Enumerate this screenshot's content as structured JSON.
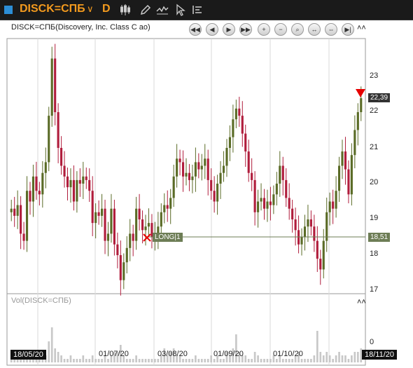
{
  "toolbar": {
    "symbol": "DISCK=СПБ",
    "dropdown_icon": "chevron-down-icon",
    "period": "D",
    "icons": [
      "candlestick-icon",
      "pencil-icon",
      "line-chart-icon",
      "cursor-icon",
      "list-icon"
    ]
  },
  "chart": {
    "title": "DISCK=СПБ(Discovery, Inc. Class C ао)",
    "vol_title": "Vol(DISCK=СПБ)",
    "nav_icons": [
      "first-icon",
      "previous-icon",
      "next-icon",
      "last-icon",
      "zoom-in-icon",
      "zoom-out-icon",
      "zoom-fit-icon",
      "compress-icon",
      "expand-icon",
      "end-icon"
    ],
    "collapse_icon": "collapse-up-icon",
    "y_ticks": [
      "23",
      "22",
      "21",
      "20",
      "19",
      "18",
      "17"
    ],
    "vol_ticks": [
      "0"
    ],
    "last_price": "22,39",
    "position_price": "18,51",
    "position_label": "LONG|1",
    "x_labels": [
      "18/05/20",
      "01/07/20",
      "03/08/20",
      "01/09/20",
      "01/10/20",
      "18/11/20"
    ],
    "colors": {
      "up": "#5a6b26",
      "down": "#b01d3c",
      "last": "#333333",
      "position": "#6d7d55",
      "sell_marker": "#e60000",
      "buy_marker": "#e60000"
    }
  },
  "chart_data": {
    "type": "candlestick",
    "y_range": [
      16.8,
      23.6
    ],
    "y_ticks": [
      17,
      18,
      19,
      20,
      21,
      22,
      23
    ],
    "x_start": "18/05/20",
    "x_end": "18/11/20",
    "close": [
      19.3,
      19.1,
      19.4,
      18.6,
      18.4,
      19.8,
      19.5,
      20.2,
      19.8,
      19.7,
      20.3,
      20.6,
      21.9,
      23.5,
      22.0,
      21.0,
      20.5,
      20.2,
      19.9,
      20.1,
      19.5,
      20.1,
      20.0,
      20.2,
      20.1,
      19.8,
      18.9,
      19.2,
      19.1,
      19.3,
      18.4,
      18.6,
      19.3,
      18.3,
      18.0,
      17.3,
      17.8,
      18.2,
      18.6,
      18.4,
      19.3,
      19.0,
      18.7,
      18.8,
      18.9,
      18.5,
      18.6,
      18.8,
      19.2,
      19.4,
      19.3,
      19.6,
      20.2,
      20.7,
      20.6,
      20.2,
      20.3,
      20.1,
      20.2,
      20.6,
      20.4,
      20.5,
      20.7,
      20.1,
      19.8,
      19.5,
      20.0,
      20.3,
      20.5,
      21.0,
      21.3,
      21.8,
      22.1,
      21.9,
      21.4,
      20.9,
      20.3,
      20.1,
      19.2,
      19.5,
      19.6,
      19.3,
      19.5,
      19.4,
      19.7,
      20.0,
      20.5,
      20.1,
      19.6,
      19.3,
      19.0,
      18.7,
      18.3,
      18.5,
      18.8,
      19.0,
      18.8,
      18.4,
      17.9,
      17.6,
      18.4,
      19.2,
      19.5,
      19.3,
      19.8,
      20.5,
      20.9,
      20.4,
      19.7,
      20.8,
      21.5,
      22.0,
      22.39
    ],
    "volume": [
      0.3,
      0.1,
      0.2,
      0.1,
      0.1,
      0.2,
      0.1,
      0.1,
      0.1,
      0.2,
      0.3,
      0.2,
      0.6,
      1.0,
      0.4,
      0.3,
      0.2,
      0.1,
      0.1,
      0.2,
      0.1,
      0.1,
      0.1,
      0.2,
      0.1,
      0.1,
      0.2,
      0.1,
      0.1,
      0.1,
      0.2,
      0.1,
      0.2,
      0.3,
      0.3,
      0.5,
      0.2,
      0.1,
      0.1,
      0.1,
      0.2,
      0.1,
      0.1,
      0.1,
      0.1,
      0.1,
      0.1,
      0.1,
      0.2,
      0.4,
      0.2,
      0.3,
      0.4,
      0.2,
      0.2,
      0.1,
      0.1,
      0.1,
      0.1,
      0.2,
      0.1,
      0.1,
      0.1,
      0.1,
      0.2,
      0.1,
      0.2,
      0.1,
      0.1,
      0.3,
      0.2,
      0.4,
      0.8,
      0.3,
      0.2,
      0.2,
      0.1,
      0.1,
      0.3,
      0.2,
      0.1,
      0.1,
      0.1,
      0.1,
      0.2,
      0.1,
      0.2,
      0.1,
      0.1,
      0.1,
      0.1,
      0.2,
      0.3,
      0.1,
      0.1,
      0.1,
      0.1,
      0.2,
      0.9,
      0.3,
      0.2,
      0.3,
      0.2,
      0.1,
      0.2,
      0.3,
      0.2,
      0.2,
      0.1,
      0.2,
      0.3,
      0.3,
      0.4
    ]
  }
}
